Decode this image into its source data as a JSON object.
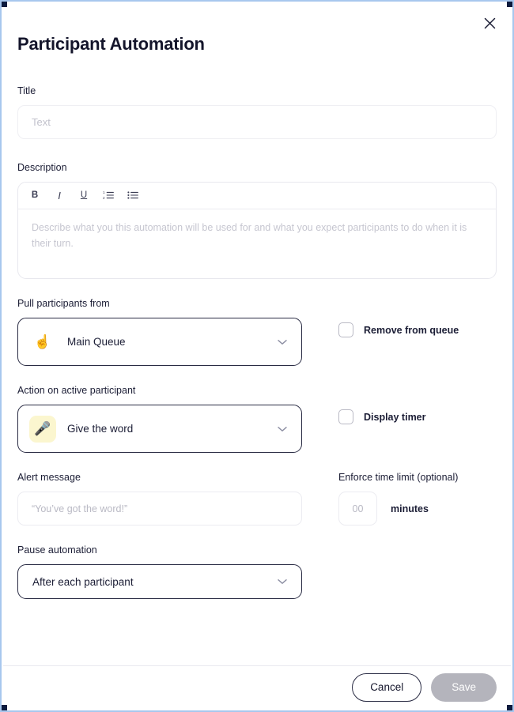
{
  "modal": {
    "title": "Participant Automation",
    "close_icon": "close-icon"
  },
  "fields": {
    "title": {
      "label": "Title",
      "value": "",
      "placeholder": "Text"
    },
    "description": {
      "label": "Description",
      "value": "",
      "placeholder": "Describe what you this automation will be used for and what you expect participants to do when it is their turn.",
      "toolbar": [
        {
          "name": "bold-button",
          "glyph": "B",
          "title": "Bold"
        },
        {
          "name": "italic-button",
          "glyph": "I",
          "title": "Italic"
        },
        {
          "name": "underline-button",
          "glyph": "U",
          "title": "Underline"
        },
        {
          "name": "ordered-list-button",
          "glyph": "ordered-list-icon",
          "title": "Numbered list"
        },
        {
          "name": "unordered-list-button",
          "glyph": "bullet-list-icon",
          "title": "Bulleted list"
        }
      ]
    },
    "pull_from": {
      "label": "Pull participants from",
      "value": "Main Queue",
      "icon": "raised-hand-icon",
      "icon_glyph": "☝"
    },
    "remove_from_queue": {
      "label": "Remove from queue",
      "checked": false
    },
    "action": {
      "label": "Action on active participant",
      "value": "Give the word",
      "icon": "microphone-icon",
      "icon_glyph": "🎤",
      "icon_background": "#fbf6cf"
    },
    "display_timer": {
      "label": "Display timer",
      "checked": false
    },
    "alert_message": {
      "label": "Alert message",
      "value": "",
      "placeholder": "“You’ve got the word!”"
    },
    "time_limit": {
      "label": "Enforce time limit (optional)",
      "value": "",
      "placeholder": "00",
      "unit": "minutes"
    },
    "pause_automation": {
      "label": "Pause automation",
      "value": "After each participant"
    }
  },
  "footer": {
    "cancel_label": "Cancel",
    "save_label": "Save",
    "save_disabled": true
  },
  "colors": {
    "frame": "#a8c7ee",
    "text": "#1b1d35",
    "heading": "#14152b",
    "placeholder": "#c2c2cc",
    "select_border": "#2a2c44",
    "save_disabled_bg": "#b4b4bc",
    "icon_tint": "#fbf6cf"
  }
}
